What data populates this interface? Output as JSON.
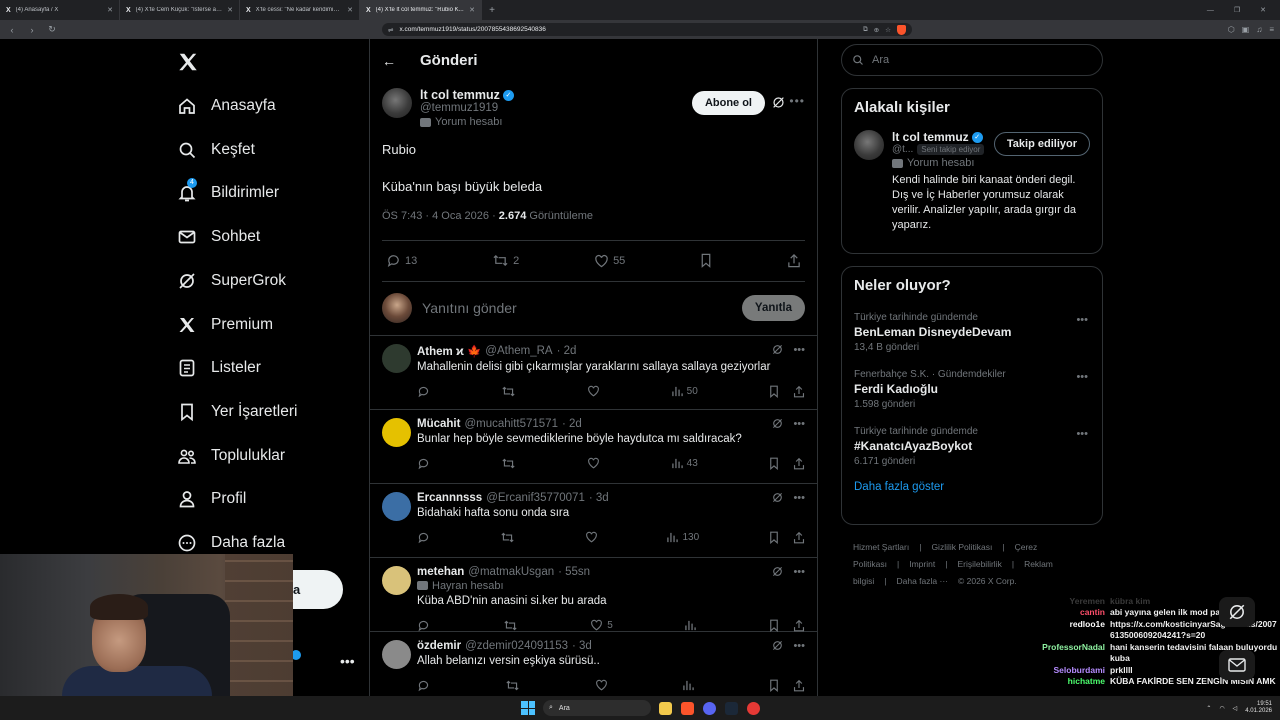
{
  "browser": {
    "tabs": [
      {
        "title": "(4) Anasayfa / X",
        "active": false
      },
      {
        "title": "(4) X'te Cem Küçük: \"İstersе ana...İran'...",
        "active": false
      },
      {
        "title": "X'te cessi: \"Ne kadar kendimiz eleştir...",
        "active": false
      },
      {
        "title": "(4) X'te lt col temmuz: \"Rubio K...",
        "active": true
      }
    ],
    "url": "x.com/temmuz1919/status/2007855438692540836"
  },
  "sidebar": {
    "items": [
      {
        "label": "Anasayfa",
        "icon": "home-icon"
      },
      {
        "label": "Keşfet",
        "icon": "search-icon"
      },
      {
        "label": "Bildirimler",
        "icon": "bell-icon",
        "badge": "4"
      },
      {
        "label": "Sohbet",
        "icon": "mail-icon"
      },
      {
        "label": "SuperGrok",
        "icon": "grok-icon"
      },
      {
        "label": "Premium",
        "icon": "x-icon"
      },
      {
        "label": "Listeler",
        "icon": "list-icon"
      },
      {
        "label": "Yer İşaretleri",
        "icon": "bookmark-icon"
      },
      {
        "label": "Topluluklar",
        "icon": "people-icon"
      },
      {
        "label": "Profil",
        "icon": "person-icon"
      },
      {
        "label": "Daha fazla",
        "icon": "more-circle-icon"
      }
    ],
    "post_button_partial": "a"
  },
  "main": {
    "title": "Gönderi",
    "post": {
      "author": "lt col temmuz",
      "handle": "@temmuz1919",
      "label": "Yorum hesabı",
      "subscribe": "Abone ol",
      "line1": "Rubio",
      "line2": "Küba'nın başı büyük beleda",
      "time": "ÖS 7:43 · 4 Oca 2026 · ",
      "views": "2.674",
      "views_label": " Görüntüleme",
      "replies": "13",
      "reposts": "2",
      "likes": "55"
    },
    "reply_box": {
      "placeholder": "Yanıtını gönder",
      "button": "Yanıtla"
    },
    "replies": [
      {
        "name": "Athem ϰ 🍁",
        "handle": "@Athem_RA",
        "time": "· 2d",
        "text": "Mahallenin delisi gibi çıkarmışlar yaraklarını sallaya sallaya geziyorlar",
        "views": "50",
        "likes": "",
        "label": "",
        "avatar": "#2e3a2f"
      },
      {
        "name": "Mücahit",
        "handle": "@mucahitt571571",
        "time": "· 2d",
        "text": "Bunlar hep böyle sevmediklerine böyle haydutca mı saldıracak?",
        "views": "43",
        "likes": "",
        "label": "",
        "avatar": "#e5c100"
      },
      {
        "name": "Ercannnsss",
        "handle": "@Ercanif35770071",
        "time": "· 3d",
        "text": "Bidahaki hafta sonu onda sıra",
        "views": "130",
        "likes": "",
        "label": "",
        "avatar": "#3b6ea5"
      },
      {
        "name": "metehan",
        "handle": "@matmakUsgan",
        "time": "· 55sn",
        "text": "Küba ABD'nin anasini si.ker bu arada",
        "views": "",
        "likes": "5",
        "label": "Hayran hesabı",
        "avatar": "#d9c27a"
      },
      {
        "name": "özdemir",
        "handle": "@zdemir024091153",
        "time": "· 3d",
        "text": "Allah belanızı versin eşkiya sürüsü..",
        "views": "",
        "likes": "",
        "label": "",
        "avatar": "#8a8a8a"
      }
    ]
  },
  "right": {
    "search_placeholder": "Ara",
    "related": {
      "title": "Alakalı kişiler",
      "name": "lt col temmuz",
      "handle": "@t...",
      "follows_you": "Seni takip ediyor",
      "button": "Takip ediliyor",
      "label": "Yorum hesabı",
      "bio": "Kendi halinde biri kanaat önderi degil. Dış ve İç Haberler yorumsuz olarak verilir. Analizler yapılır, arada gırgır da yaparız."
    },
    "trends": {
      "title": "Neler oluyor?",
      "items": [
        {
          "context": "Türkiye tarihinde gündemde",
          "name": "BenLeman DisneydeDevam",
          "count": "13,4 B gönderi"
        },
        {
          "context": "Fenerbahçe S.K. · Gündemdekiler",
          "name": "Ferdi Kadıoğlu",
          "count": "1.598 gönderi"
        },
        {
          "context": "Türkiye tarihinde gündemde",
          "name": "#KanatcıAyazBoykot",
          "count": "6.171 gönderi"
        }
      ],
      "show_more": "Daha fazla göster"
    },
    "footer": [
      "Hizmet Şartları",
      "|",
      "Gizlilik Politikası",
      "|",
      "Çerez Politikası",
      "|",
      "Imprint",
      "|",
      "Erişilebilirlik",
      "|",
      "Reklam bilgisi",
      "|",
      "Daha fazla ···",
      "© 2026 X Corp."
    ]
  },
  "chat": [
    {
      "user": "Yeremen",
      "msg": "kübra kim",
      "color": "#3a3a3a"
    },
    {
      "user": "cantin",
      "msg": "abi yayına gelen ilk mod papeloldu",
      "color": "#ff4f6b"
    },
    {
      "user": "redloo1e",
      "msg": "https://x.com/kosticinyarSagi/status/2007613500609204241?s=20",
      "color": "#ffffff"
    },
    {
      "user": "ProfessorNadal",
      "msg": "hani kanserin tedavisini falaan buluyordu kuba",
      "color": "#8ef0a0"
    },
    {
      "user": "Seloburdami",
      "msg": "prkllll",
      "color": "#b58cff"
    },
    {
      "user": "hichatme",
      "msg": "KÜBA FAKİRDE SEN ZENGİN MİSİN AMK",
      "color": "#4cff6e"
    }
  ],
  "taskbar": {
    "search": "Ara",
    "time": "19:51",
    "date": "4.01.2026"
  },
  "colors": {
    "accent": "#1d9bf0",
    "background": "#000000",
    "border": "#2f3336",
    "muted": "#71767b"
  }
}
